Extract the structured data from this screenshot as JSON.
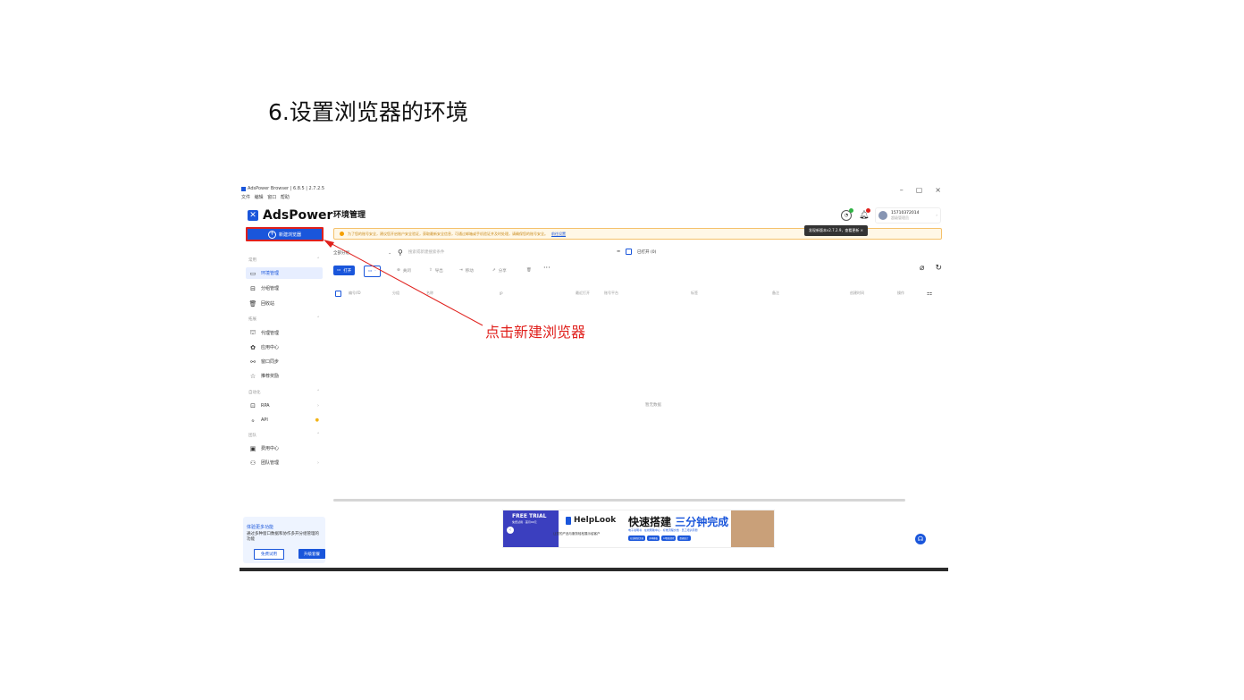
{
  "slide": {
    "title": "6.设置浏览器的环境"
  },
  "annotation": {
    "text": "点击新建浏览器",
    "color": "#e0201c"
  },
  "colors": {
    "accent": "#1a56db",
    "annotation": "#e0201c",
    "notice_bg": "#fff7e6",
    "notice_text": "#c98a1a"
  },
  "window": {
    "title": "AdsPower Browser | 6.8.5 | 2.7.2.5",
    "menu": [
      "文件",
      "编辑",
      "窗口",
      "帮助"
    ],
    "controls": {
      "minimize": "–",
      "maximize": "▢",
      "close": "×"
    }
  },
  "sidebar": {
    "brand": "AdsPower",
    "brand_icon": "adspower-logo-icon",
    "new_button": "新建浏览器",
    "groups": {
      "common": "常用",
      "extended": "拓展",
      "automation": "自动化",
      "team": "团队"
    },
    "items": {
      "env": "环境管理",
      "groups": "分组管理",
      "trash": "回收站",
      "proxy": "代理管理",
      "apps": "应用中心",
      "sync": "窗口同步",
      "rewards": "推荐奖励",
      "rpa": "RPA",
      "api": "API",
      "billing": "费用中心",
      "team": "团队管理"
    },
    "promo": {
      "title": "体验更多功能",
      "body": "通过多种窗口数据和协作多开分组管理的功能",
      "trial": "免费试用",
      "upgrade": "升级套餐"
    }
  },
  "main": {
    "title": "环境管理",
    "notice": "为了您的账号安全，建议您开启账户安全验证，获取最新安全信息，可通过邮箱或手机验证并及时处理，请确保您的账号安全。",
    "notice_link": "前往设置",
    "tooltip": "发现新版本v2.7.2.9，查看更新",
    "account": {
      "phone": "15710372014",
      "role": "超级管理员"
    },
    "filter": {
      "group_select": "全部分组",
      "search_placeholder": "搜索或新建搜索条件",
      "opened": "已打开 (0)"
    },
    "toolbar": {
      "open": "打开",
      "close": "关闭",
      "export": "导出",
      "move": "移动",
      "share": "分享",
      "more": "···"
    },
    "columns": [
      "编号/ID",
      "分组",
      "名称",
      "IP",
      "最近打开",
      "账号平台",
      "标签",
      "备注",
      "创建时间",
      "操作"
    ],
    "empty_text": "暂无数据",
    "banner": {
      "free_trial": "FREE TRIAL",
      "free_sub": "免费试用 · 首月99元",
      "brand": "HelpLook",
      "brand_sub": "让您的产品与服务轻松展示给客户",
      "headline_a": "快速搭建",
      "headline_b": "三分钟完成",
      "desc": "电子说明书 · 在线帮助中心 · 标准流程文档 · 员工培训手册",
      "pills": [
        "在线帮助文档",
        "多种模板",
        "AI智能搜索",
        "数据统计"
      ]
    }
  }
}
